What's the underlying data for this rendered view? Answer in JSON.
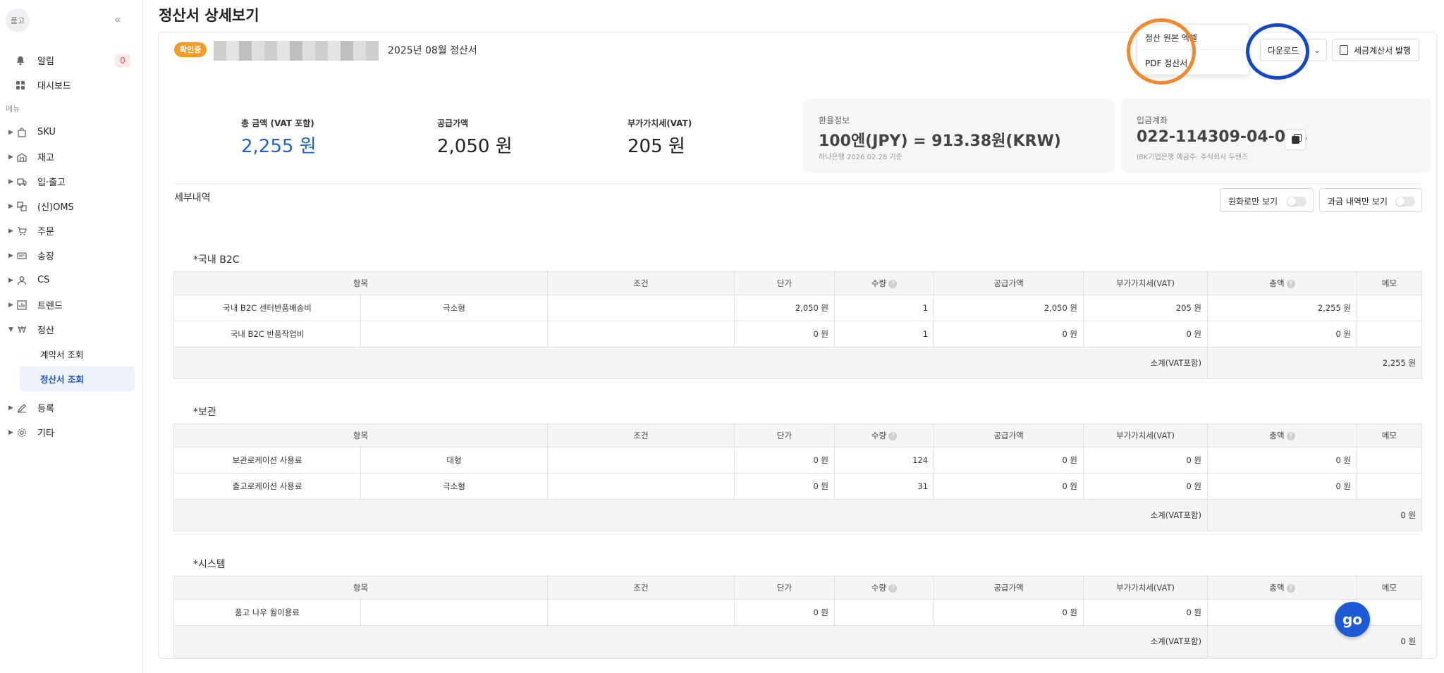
{
  "sidebar": {
    "logo": "품고",
    "collapse_icon": "«",
    "top_items": [
      {
        "label": "알림",
        "icon": "bell-icon",
        "badge": "0"
      },
      {
        "label": "대시보드",
        "icon": "grid-icon"
      }
    ],
    "menu_title": "메뉴",
    "items": [
      {
        "label": "SKU"
      },
      {
        "label": "재고"
      },
      {
        "label": "입·출고"
      },
      {
        "label": "(신)OMS"
      },
      {
        "label": "주문"
      },
      {
        "label": "송장"
      },
      {
        "label": "CS"
      },
      {
        "label": "트렌드"
      },
      {
        "label": "정산"
      },
      {
        "label": "등록"
      },
      {
        "label": "기타"
      }
    ],
    "sub_items": [
      {
        "label": "계약서 조회"
      },
      {
        "label": "정산서 조회"
      }
    ]
  },
  "page": {
    "title": "정산서 상세보기"
  },
  "header": {
    "status": "확인중",
    "period": "2025년 08월 정산서",
    "dropdown": {
      "item1": "정산 원본 엑셀",
      "item2": "PDF 정산서"
    },
    "download_label": "다운로드",
    "tax_invoice_label": "세금계산서 발행"
  },
  "summary": {
    "total_label": "총 금액 (VAT 포함)",
    "total_value": "2,255 원",
    "supply_label": "공급가액",
    "supply_value": "2,050 원",
    "vat_label": "부가가치세(VAT)",
    "vat_value": "205 원"
  },
  "exchange": {
    "label": "환율정보",
    "value": "100엔(JPY) = 913.38원(KRW)",
    "sub": "하나은행 2026.02.28 기준"
  },
  "account": {
    "label": "입금계좌",
    "value": "022-114309-04-014",
    "sub": "IBK기업은행 예금주: 주식회사 두핸즈"
  },
  "details": {
    "title": "세부내역",
    "toggle_krw": "원화로만 보기",
    "toggle_billed": "과금 내역만 보기",
    "columns": {
      "item": "항목",
      "cond": "조건",
      "unit": "단가",
      "qty": "수량",
      "supply": "공급가액",
      "vat": "부가가치세(VAT)",
      "total": "총액",
      "memo": "메모"
    },
    "subtotal_label": "소계(VAT포함)",
    "sections": [
      {
        "title": "*국내 B2C",
        "rows": [
          {
            "item": "국내 B2C 센터반품배송비",
            "type": "극소형",
            "cond": "",
            "unit": "2,050 원",
            "qty": "1",
            "supply": "2,050 원",
            "vat": "205 원",
            "total": "2,255 원",
            "memo": ""
          },
          {
            "item": "국내 B2C 반품작업비",
            "type": "",
            "cond": "",
            "unit": "0 원",
            "qty": "1",
            "supply": "0 원",
            "vat": "0 원",
            "total": "0 원",
            "memo": ""
          }
        ],
        "subtotal": "2,255 원"
      },
      {
        "title": "*보관",
        "rows": [
          {
            "item": "보관로케이션 사용료",
            "type": "대형",
            "cond": "",
            "unit": "0 원",
            "qty": "124",
            "supply": "0 원",
            "vat": "0 원",
            "total": "0 원",
            "memo": ""
          },
          {
            "item": "출고로케이션 사용료",
            "type": "극소형",
            "cond": "",
            "unit": "0 원",
            "qty": "31",
            "supply": "0 원",
            "vat": "0 원",
            "total": "0 원",
            "memo": ""
          }
        ],
        "subtotal": "0 원"
      },
      {
        "title": "*시스템",
        "rows": [
          {
            "item": "품고 나우 월이용료",
            "type": "",
            "cond": "",
            "unit": "0 원",
            "qty": "",
            "supply": "0 원",
            "vat": "0 원",
            "total": "",
            "memo": ""
          }
        ],
        "subtotal": "0 원"
      }
    ]
  },
  "fab": {
    "label": "go"
  },
  "colors": {
    "accent": "#1e63c8",
    "status": "#f59b23",
    "annotation_orange": "#f3882c",
    "annotation_blue": "#1448c4"
  }
}
